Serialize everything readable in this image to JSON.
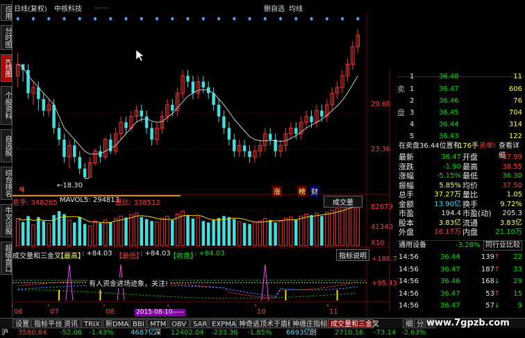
{
  "sidebar_tabs": [
    {
      "label": "应用",
      "active": false
    },
    {
      "label": "分时图",
      "active": false
    },
    {
      "label": "K线图",
      "active": true
    },
    {
      "label": "个股资料",
      "active": false
    },
    {
      "label": "自选股",
      "active": false
    },
    {
      "label": "综合排名",
      "active": false
    },
    {
      "label": "牛叉诊股",
      "active": false
    },
    {
      "label": "超级盘口",
      "active": false
    }
  ],
  "header": {
    "chart_mode": "日线(复权)",
    "stock_name": "中核科技",
    "btn_watchlist": "删自选",
    "btn_next": "均线",
    "legend_line": "......"
  },
  "chart_labels": {
    "price_hi": "29.68",
    "price_mid": "23.36",
    "low_marker": "←18.30",
    "q_mark": "q",
    "event_tags": [
      "涨",
      "榜",
      "财"
    ]
  },
  "volume_panel": {
    "total_label": "总手: 348265",
    "mavol5": "MAVOL5: 294813",
    "liang_bi": "量比: 338512",
    "button": "成交量",
    "y_hi": "82679",
    "y_mid": "41340",
    "y_unit": "X10"
  },
  "indicator_panel": {
    "title": "成交量和三金叉",
    "hi_label": "【最高】",
    "hi_value": ": +84.03",
    "lo_label": "【最低】",
    "lo_value": ": +84.03",
    "close_label": "【收盘】",
    "close_value": ": +84.03",
    "button": "指标说明",
    "y_hi": "+188.7",
    "y_mid": "+95.43",
    "notice": "有人资金进场迹象，关注!",
    "date_highlight": "2015-08-10-----"
  },
  "x_axis": [
    "06",
    "07",
    "08",
    "09",
    "10",
    "11"
  ],
  "chart_data": {
    "type": "candlestick",
    "title": "日线(复权) 中核科技",
    "price_labels": [
      29.68,
      23.36
    ],
    "low_mark": 18.3,
    "volume_labels": [
      82679,
      41340
    ],
    "volume_unit": "X10",
    "indicator_labels": [
      188.7,
      95.43
    ],
    "x_ticks": [
      "06",
      "07",
      "08",
      "09",
      "10",
      "11"
    ],
    "candles": [
      [
        36,
        38,
        40,
        34,
        1
      ],
      [
        38,
        37,
        38,
        35,
        0
      ],
      [
        37,
        33,
        38,
        32,
        0
      ],
      [
        33,
        34,
        35,
        31,
        1
      ],
      [
        34,
        32,
        35,
        30,
        0
      ],
      [
        32,
        30,
        33,
        29,
        0
      ],
      [
        30,
        31,
        32,
        29,
        1
      ],
      [
        31,
        27,
        32,
        26,
        0
      ],
      [
        27,
        25,
        28,
        24,
        0
      ],
      [
        25,
        22,
        26,
        21,
        0
      ],
      [
        22,
        24,
        25,
        20,
        1
      ],
      [
        24,
        22,
        25,
        21,
        0
      ],
      [
        22,
        20,
        23,
        19,
        0
      ],
      [
        20,
        18.5,
        21,
        18.3,
        0
      ],
      [
        18.5,
        21,
        22,
        18.5,
        1
      ],
      [
        21,
        23,
        23.5,
        20.5,
        1
      ],
      [
        23,
        22,
        24,
        21,
        0
      ],
      [
        22,
        25,
        25.5,
        21.5,
        1
      ],
      [
        25,
        23,
        26,
        22.5,
        0
      ],
      [
        23,
        26,
        27,
        22.5,
        1
      ],
      [
        26,
        28,
        29,
        25,
        1
      ],
      [
        28,
        27,
        29,
        26,
        0
      ],
      [
        27,
        29,
        30,
        26.5,
        1
      ],
      [
        29,
        30,
        31,
        28,
        1
      ],
      [
        30,
        29,
        31,
        28,
        0
      ],
      [
        29,
        27,
        30,
        26,
        0
      ],
      [
        27,
        25,
        28,
        24,
        0
      ],
      [
        25,
        27,
        28,
        24,
        1
      ],
      [
        27,
        29,
        30,
        26,
        1
      ],
      [
        29,
        31,
        32,
        28,
        1
      ],
      [
        31,
        30,
        32,
        29,
        0
      ],
      [
        30,
        33,
        34,
        29,
        1
      ],
      [
        33,
        36,
        37,
        32,
        1
      ],
      [
        36,
        35,
        37,
        34,
        0
      ],
      [
        35,
        33,
        36,
        32,
        0
      ],
      [
        33,
        35,
        36,
        32,
        1
      ],
      [
        35,
        34,
        36,
        33,
        0
      ],
      [
        34,
        33,
        35,
        32,
        0
      ],
      [
        33,
        31,
        34,
        30,
        0
      ],
      [
        31,
        29,
        32,
        28,
        0
      ],
      [
        29,
        27,
        30,
        26,
        0
      ],
      [
        27,
        25,
        28,
        24,
        0
      ],
      [
        25,
        23,
        26,
        22,
        0
      ],
      [
        23,
        24,
        25,
        22,
        1
      ],
      [
        24,
        23,
        25,
        22,
        0
      ],
      [
        23,
        22,
        24,
        21,
        0
      ],
      [
        22,
        23,
        24,
        21,
        1
      ],
      [
        23,
        24,
        25,
        22,
        1
      ],
      [
        24,
        26,
        27,
        23,
        1
      ],
      [
        26,
        25,
        27,
        24,
        0
      ],
      [
        25,
        23,
        26,
        22,
        0
      ],
      [
        23,
        24,
        25,
        22,
        1
      ],
      [
        24,
        26,
        27,
        23,
        1
      ],
      [
        26,
        27,
        28,
        25,
        1
      ],
      [
        27,
        26,
        28,
        25,
        0
      ],
      [
        26,
        28,
        29,
        25,
        1
      ],
      [
        28,
        29,
        30,
        27,
        1
      ],
      [
        29,
        28,
        30,
        27,
        0
      ],
      [
        28,
        30,
        31,
        27,
        1
      ],
      [
        30,
        29,
        31,
        28,
        0
      ],
      [
        29,
        31,
        32,
        28,
        1
      ],
      [
        31,
        33,
        34,
        30,
        1
      ],
      [
        33,
        34,
        35,
        32,
        1
      ],
      [
        34,
        36,
        37,
        33,
        1
      ],
      [
        36,
        38,
        39,
        35,
        1
      ],
      [
        38,
        41,
        42,
        37,
        1
      ],
      [
        41,
        43,
        44,
        40,
        1
      ]
    ],
    "volumes": [
      55,
      48,
      60,
      42,
      58,
      50,
      45,
      62,
      70,
      64,
      52,
      47,
      58,
      44,
      40,
      50,
      46,
      52,
      48,
      55,
      60,
      57,
      63,
      66,
      58,
      54,
      50,
      48,
      56,
      60,
      52,
      64,
      70,
      62,
      55,
      58,
      50,
      47,
      52,
      56,
      60,
      58,
      54,
      49,
      46,
      44,
      48,
      50,
      55,
      52,
      47,
      50,
      56,
      58,
      52,
      60,
      64,
      62,
      66,
      60,
      68,
      72,
      75,
      78,
      80,
      82,
      76
    ],
    "ma_line": [
      38,
      37.5,
      36,
      35,
      34,
      33,
      32,
      31,
      29,
      27,
      26,
      25,
      24,
      23,
      22.5,
      22.5,
      22.6,
      23,
      23.5,
      24,
      25,
      26,
      27,
      28,
      28.5,
      28.6,
      28.2,
      28,
      28.1,
      28.8,
      29.5,
      30.5,
      31.5,
      32.5,
      33,
      33.5,
      33.6,
      33.5,
      33,
      32,
      31,
      29.8,
      28.5,
      27.5,
      26.5,
      25.5,
      25,
      24.8,
      24.8,
      24.9,
      24.8,
      24.7,
      24.8,
      25.2,
      25.7,
      26.3,
      27,
      27.5,
      28,
      28.5,
      29.2,
      30,
      30.8,
      31.8,
      33,
      34.5,
      36
    ]
  },
  "quote": {
    "ask": [
      {
        "label": "卖",
        "level": "1",
        "price": "36.47",
        "vol": "606"
      },
      {
        "level": "2",
        "price": "36.46",
        "vol": "76"
      },
      {
        "label": "盘",
        "level": "3",
        "price": "36.45",
        "vol": "704"
      },
      {
        "level": "4",
        "price": "36.44",
        "vol": "314"
      },
      {
        "level": "5",
        "price": "36.43",
        "vol": "122"
      }
    ],
    "ask_top_partial": {
      "level": "1",
      "price": "36.48",
      "vol": "11"
    },
    "pending": "在卖盘36.44位置有",
    "pending_vol": "176手",
    "pending_sell": "卖单!",
    "pending_detail": "查看详细",
    "stats": [
      [
        "最新",
        "36.47",
        "开盘",
        "37.99"
      ],
      [
        "涨跌",
        "-1.90",
        "最高",
        "38.55"
      ],
      [
        "涨幅",
        "-5.15%",
        "最低",
        "36.30"
      ],
      [
        "振幅",
        "5.85%",
        "均价",
        "37.50"
      ],
      [
        "总手",
        "37.27万",
        "量比",
        "1.05"
      ],
      [
        "金额",
        "13.90亿",
        "换手",
        "9.72%"
      ],
      [
        "市盈",
        "194.4",
        "市盈(动)",
        "205.3"
      ],
      [
        "股本",
        "3.83亿",
        "流通",
        "3.83亿"
      ],
      [
        "外盘",
        "16.17万",
        "内盘",
        "21.10万"
      ]
    ],
    "sector_name": "通用设备",
    "sector_change": "-3.28%",
    "sector_btn": "同行业比较",
    "ticks": [
      [
        "14:56",
        "36.44",
        "139",
        "↑",
        "22"
      ],
      [
        "14:56",
        "36.47",
        "187",
        "↑",
        "33"
      ],
      [
        "14:56",
        "36.46",
        "168",
        "↓",
        "29"
      ],
      [
        "14:56",
        "36.47",
        "53",
        "↑",
        "15"
      ],
      [
        "14:56",
        "36.47",
        "57",
        "↓",
        "9"
      ]
    ]
  },
  "bottom_tabs": [
    "设置",
    "指标平台",
    "资讯",
    "TRIX",
    "新DMA",
    "BBI",
    "MTM",
    "OBV",
    "SAR",
    "EXPMA",
    "神奇逃顶术于盾线",
    "神缠庄指标",
    "成交量和三金叉"
  ],
  "bottom_nav": [
    "细",
    "分",
    "价"
  ],
  "status": {
    "idx1_name": "沪",
    "idx1_val": "3580.84",
    "idx1_chg": "-52.06",
    "idx1_pct": "-1.43%",
    "idx1_amt": "4687亿",
    "idx2_name": "深",
    "idx2_val": "12402.04",
    "idx2_chg": "-233.36",
    "idx2_pct": "-1.85%",
    "idx2_amt": "6693亿",
    "idx3_name": "创",
    "idx3_val": "2710.16",
    "idx3_chg": "-73.14",
    "idx3_pct": "-2.63%",
    "watermark": "www.7gpzb.com"
  }
}
